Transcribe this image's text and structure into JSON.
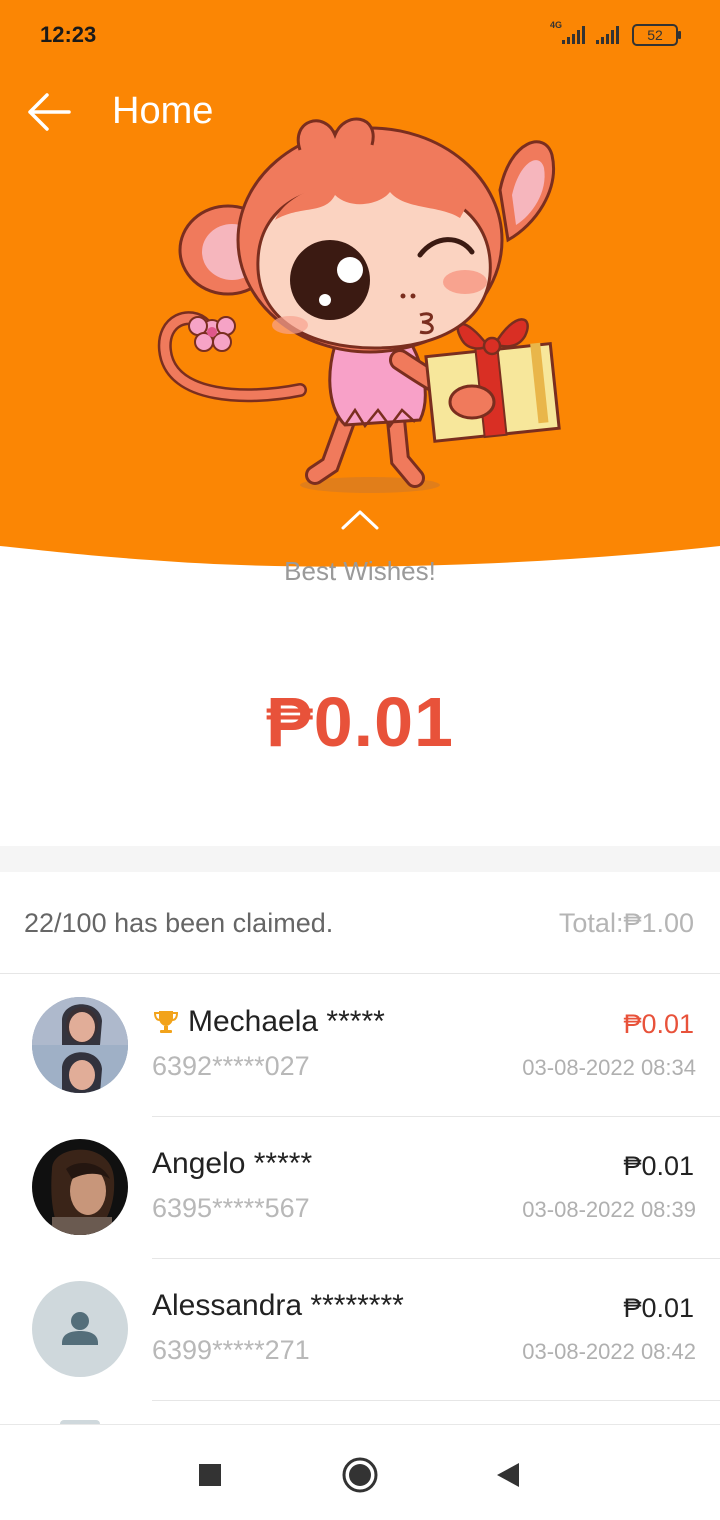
{
  "status_bar": {
    "time": "12:23",
    "network": "4G",
    "battery": "52"
  },
  "header": {
    "title": "Home",
    "back_icon": "arrow-left-icon",
    "collapse_icon": "chevron-up-icon",
    "bg_color": "#fb8604"
  },
  "packet": {
    "wishes": "Best Wishes!",
    "amount": "₱0.01",
    "accent_color": "#e8523a"
  },
  "summary": {
    "claimed_text": "22/100 has been claimed.",
    "total_text": "Total:₱1.00"
  },
  "claims": [
    {
      "name": "Mechaela *****",
      "phone": "6392*****027",
      "amount": "₱0.01",
      "time": "03-08-2022 08:34",
      "best": true,
      "badge_icon": "trophy-icon"
    },
    {
      "name": "Angelo *****",
      "phone": "6395*****567",
      "amount": "₱0.01",
      "time": "03-08-2022 08:39",
      "best": false
    },
    {
      "name": "Alessandra ********",
      "phone": "6399*****271",
      "amount": "₱0.01",
      "time": "03-08-2022 08:42",
      "best": false
    }
  ],
  "nav": {
    "recents_icon": "square-icon",
    "home_icon": "circle-icon",
    "back_icon": "triangle-back-icon"
  }
}
